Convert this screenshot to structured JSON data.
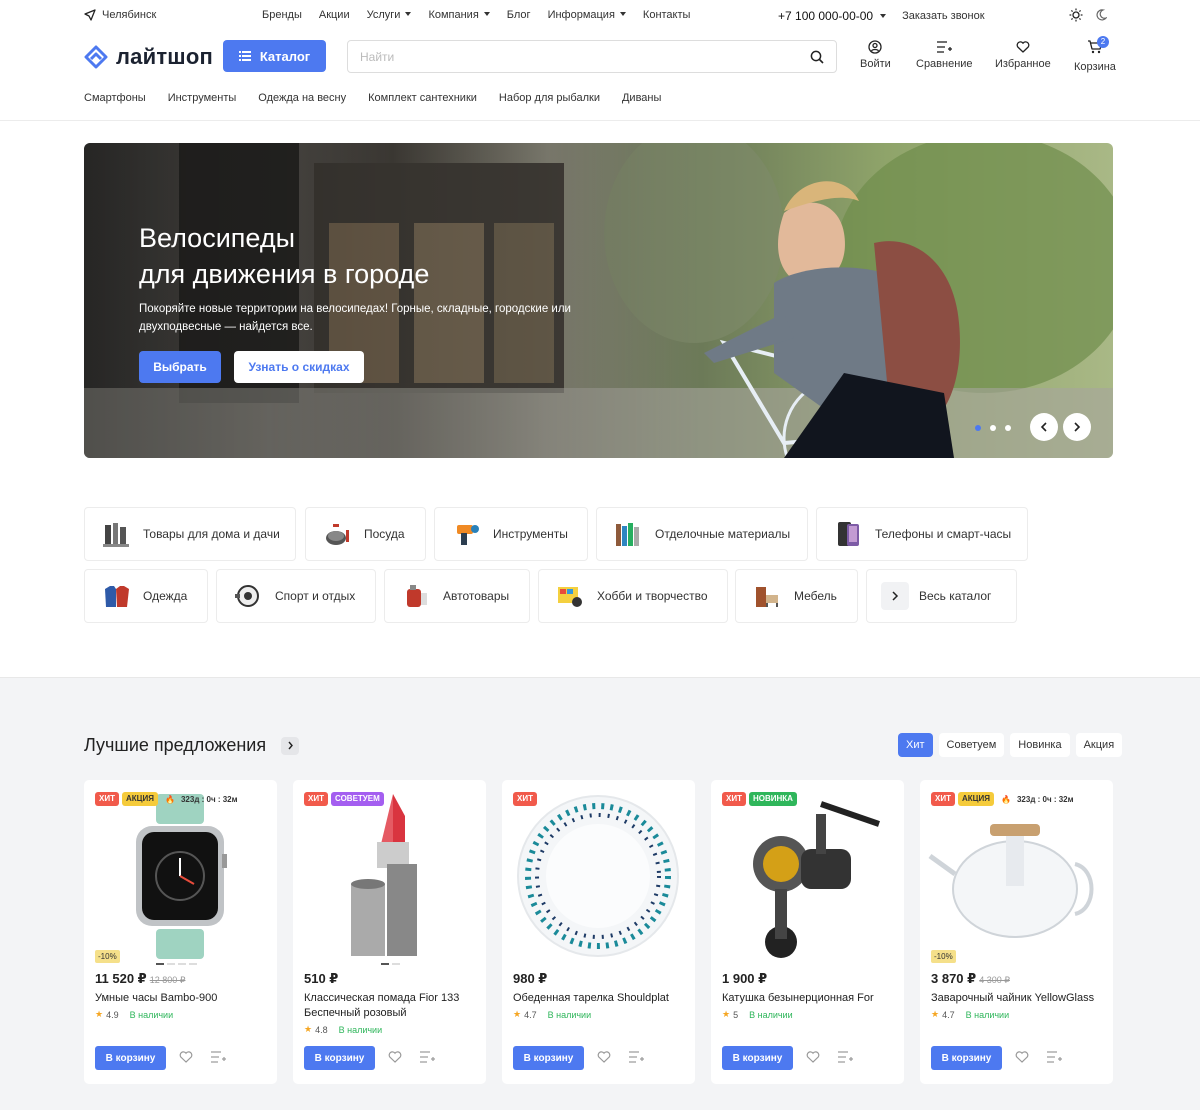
{
  "topbar": {
    "city": "Челябинск",
    "menu": [
      "Бренды",
      "Акции",
      "Услуги",
      "Компания",
      "Блог",
      "Информация",
      "Контакты"
    ],
    "phone": "+7 100 000-00-00",
    "callback": "Заказать звонок"
  },
  "header": {
    "logo": "лайтшоп",
    "catalog_label": "Каталог",
    "search_placeholder": "Найти",
    "icons": {
      "login": "Войти",
      "compare": "Сравнение",
      "favorites": "Избранное",
      "cart": "Корзина",
      "cart_count": "2"
    },
    "quick_links": [
      "Смартфоны",
      "Инструменты",
      "Одежда на весну",
      "Комплект сантехники",
      "Набор для рыбалки",
      "Диваны"
    ]
  },
  "hero": {
    "title_line1": "Велосипеды",
    "title_line2": "для движения в городе",
    "text": "Покоряйте новые территории на велосипедах! Горные, складные, городские или двухподвесные — найдется все.",
    "btn_primary": "Выбрать",
    "btn_secondary": "Узнать о скидках"
  },
  "categories": [
    "Товары для дома и дачи",
    "Посуда",
    "Инструменты",
    "Отделочные материалы",
    "Телефоны и смарт-часы",
    "Одежда",
    "Спорт и отдых",
    "Автотовары",
    "Хобби и творчество",
    "Мебель",
    "Весь каталог"
  ],
  "offers": {
    "title": "Лучшие предложения",
    "tabs": [
      "Хит",
      "Советуем",
      "Новинка",
      "Акция"
    ],
    "cta": "В корзину",
    "products": [
      {
        "tags": [
          "ХИТ",
          "АКЦИЯ"
        ],
        "timer": "323д : 0ч : 32м",
        "discount": "-10%",
        "price": "11 520 ₽",
        "old_price": "12 800 ₽",
        "name": "Умные часы Bambo-900",
        "rating": "4.9",
        "stock": "В наличии"
      },
      {
        "tags": [
          "ХИТ",
          "СОВЕТУЕМ"
        ],
        "price": "510 ₽",
        "name": "Классическая помада Fior 133 Беспечный розовый",
        "rating": "4.8",
        "stock": "В наличии"
      },
      {
        "tags": [
          "ХИТ"
        ],
        "price": "980 ₽",
        "name": "Обеденная тарелка Shouldplat",
        "rating": "4.7",
        "stock": "В наличии"
      },
      {
        "tags": [
          "ХИТ",
          "НОВИНКА"
        ],
        "price": "1 900 ₽",
        "name": "Катушка безынерционная For",
        "rating": "5",
        "stock": "В наличии"
      },
      {
        "tags": [
          "ХИТ",
          "АКЦИЯ"
        ],
        "timer": "323д : 0ч : 32м",
        "discount": "-10%",
        "price": "3 870 ₽",
        "old_price": "4 300 ₽",
        "name": "Заварочный чайник YellowGlass",
        "rating": "4.7",
        "stock": "В наличии"
      }
    ]
  },
  "colors": {
    "accent": "#4d79f0",
    "hit": "#f15a4b",
    "action": "#f5cb3b",
    "recommend": "#a45ef0",
    "new": "#2fb65b"
  }
}
